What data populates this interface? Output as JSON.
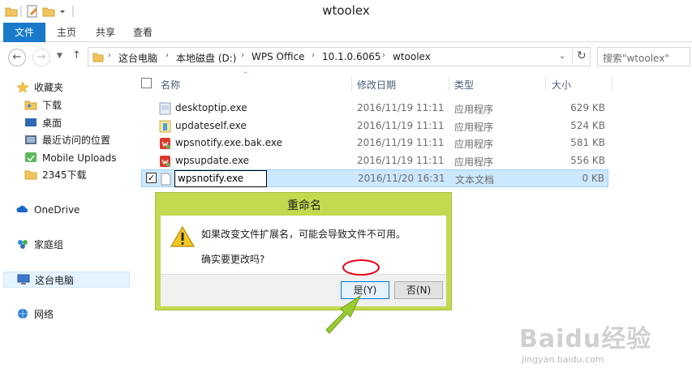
{
  "window": {
    "title": "wtoolex"
  },
  "ribbon": {
    "tabs": [
      {
        "label": "文件"
      },
      {
        "label": "主页"
      },
      {
        "label": "共享"
      },
      {
        "label": "查看"
      }
    ]
  },
  "navigation": {
    "breadcrumb": [
      "这台电脑",
      "本地磁盘 (D:)",
      "WPS Office",
      "10.1.0.6065",
      "wtoolex"
    ],
    "search_placeholder": "搜索\"wtoolex\""
  },
  "sidebar": {
    "items": [
      {
        "label": "收藏夹",
        "icon": "star-icon"
      },
      {
        "label": "下载",
        "icon": "download-folder-icon"
      },
      {
        "label": "桌面",
        "icon": "desktop-icon"
      },
      {
        "label": "最近访问的位置",
        "icon": "recent-places-icon"
      },
      {
        "label": "Mobile Uploads",
        "icon": "mobile-uploads-icon"
      },
      {
        "label": "2345下载",
        "icon": "folder-icon"
      },
      {
        "label": "OneDrive",
        "icon": "onedrive-icon"
      },
      {
        "label": "家庭组",
        "icon": "homegroup-icon"
      },
      {
        "label": "这台电脑",
        "icon": "computer-icon"
      },
      {
        "label": "网络",
        "icon": "network-icon"
      }
    ]
  },
  "filelist": {
    "columns": [
      "名称",
      "修改日期",
      "类型",
      "大小"
    ],
    "rows": [
      {
        "name": "desktoptip.exe",
        "date": "2016/11/19 11:11",
        "type": "应用程序",
        "size": "629 KB",
        "icon": "exe-icon"
      },
      {
        "name": "updateself.exe",
        "date": "2016/11/19 11:11",
        "type": "应用程序",
        "size": "524 KB",
        "icon": "update-exe-icon"
      },
      {
        "name": "wpsnotify.exe.bak.exe",
        "date": "2016/11/19 11:11",
        "type": "应用程序",
        "size": "581 KB",
        "icon": "wps-exe-icon"
      },
      {
        "name": "wpsupdate.exe",
        "date": "2016/11/19 11:11",
        "type": "应用程序",
        "size": "556 KB",
        "icon": "wps-exe-icon"
      },
      {
        "name": "wpsnotify.exe",
        "date": "2016/11/20 16:31",
        "type": "文本文档",
        "size": "0 KB",
        "icon": "text-file-icon",
        "renaming": true,
        "checked": true
      }
    ]
  },
  "dialog": {
    "title": "重命名",
    "message": "如果改变文件扩展名，可能会导致文件不可用。",
    "confirm": "确实要更改吗?",
    "yes_label": "是(Y)",
    "no_label": "否(N)"
  },
  "watermark": {
    "brand": "Baidu经验",
    "sub": "jingyan.baidu.com"
  },
  "colors": {
    "file_tab": "#1979ca",
    "dialog_frame": "#c3d950",
    "selection": "#cce8ff",
    "highlight_circle": "#e60012",
    "arrow": "#9acd32"
  }
}
